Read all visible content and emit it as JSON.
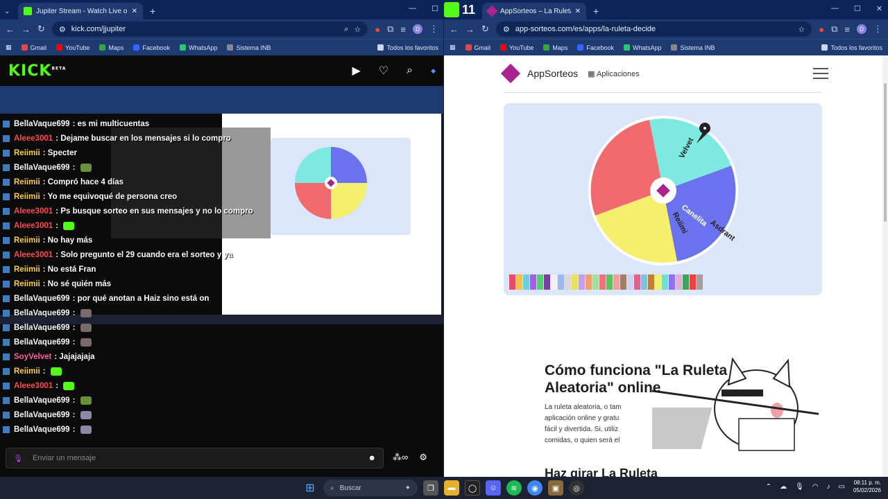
{
  "left_window": {
    "tab_title": "Jupiter Stream - Watch Live on",
    "url": "kick.com/jjupiter",
    "profile": "D",
    "bookmarks": [
      "Gmail",
      "YouTube",
      "Maps",
      "Facebook",
      "WhatsApp",
      "Sistema INB"
    ],
    "favorites": "Todos los favoritos",
    "kick_logo": "KICK",
    "kick_beta": "BETA",
    "chat": [
      {
        "user": "BellaVaque699",
        "text": "es mi multicuentas",
        "color": "#ffffff"
      },
      {
        "user": "Aleee3001",
        "text": "Dejame buscar en los mensajes si lo compro",
        "color": "#ff4d4d"
      },
      {
        "user": "Reiimii",
        "text": "Specter",
        "color": "#ffd23e"
      },
      {
        "user": "BellaVaque699",
        "text": "",
        "color": "#ffffff",
        "emote": "#6b8f3a"
      },
      {
        "user": "Reiimii",
        "text": "Compró hace 4 días",
        "color": "#ffd23e"
      },
      {
        "user": "Reiimii",
        "text": "Yo me equivoqué de persona creo",
        "color": "#ffd23e"
      },
      {
        "user": "Aleee3001",
        "text": "Ps busque sorteo en sus mensajes y no lo compro",
        "color": "#ff4d4d"
      },
      {
        "user": "Aleee3001",
        "text": "",
        "color": "#ff4d4d",
        "emote": "#53fc18"
      },
      {
        "user": "Reiimii",
        "text": "No hay más",
        "color": "#ffd23e"
      },
      {
        "user": "Aleee3001",
        "text": "Solo pregunto el 29 cuando era el sorteo y ya",
        "color": "#ff4d4d"
      },
      {
        "user": "Reiimii",
        "text": "No está Fran",
        "color": "#ffd23e"
      },
      {
        "user": "Reiimii",
        "text": "No sé quién más",
        "color": "#ffd23e"
      },
      {
        "user": "BellaVaque699",
        "text": "por qué anotan a Haiz sino está on",
        "color": "#ffffff"
      },
      {
        "user": "BellaVaque699",
        "text": "",
        "color": "#ffffff",
        "emote": "#7a6a6a"
      },
      {
        "user": "BellaVaque699",
        "text": "",
        "color": "#ffffff",
        "emote": "#7a6a6a"
      },
      {
        "user": "BellaVaque699",
        "text": "",
        "color": "#ffffff",
        "emote": "#7a6a6a"
      },
      {
        "user": "SoyVelvet",
        "text": "Jajajajaja",
        "color": "#ff5fa8"
      },
      {
        "user": "Reiimii",
        "text": "",
        "color": "#ffd23e",
        "emote": "#53fc18"
      },
      {
        "user": "Aleee3001",
        "text": "",
        "color": "#ff4d4d",
        "emote": "#53fc18"
      },
      {
        "user": "BellaVaque699",
        "text": "",
        "color": "#ffffff",
        "emote": "#6b8f3a"
      },
      {
        "user": "BellaVaque699",
        "text": "",
        "color": "#ffffff",
        "emote": "#8a8aa6"
      },
      {
        "user": "BellaVaque699",
        "text": "",
        "color": "#ffffff",
        "emote": "#8a8aa6"
      }
    ],
    "chat_placeholder": "Enviar un mensaje"
  },
  "right_window": {
    "tab_title": "AppSorteos – La Ruleta de la Su",
    "url": "app-sorteos.com/es/apps/la-ruleta-decide",
    "profile": "D",
    "bookmarks": [
      "Gmail",
      "YouTube",
      "Maps",
      "Facebook",
      "WhatsApp",
      "Sistema INB"
    ],
    "favorites": "Todos los favoritos",
    "brand": "AppSorteos",
    "apps_label": "Aplicaciones",
    "wheel_labels": [
      "Velvet",
      "Canelita",
      "Reiimi",
      "Asdrant"
    ],
    "wheel_colors": [
      "#7de9e0",
      "#6b72ee",
      "#f5ef6e",
      "#f06a6e"
    ],
    "heading1": "Cómo funciona \"La Ruleta",
    "heading1b": "Aleatoria\" online",
    "paragraph": [
      "La ruleta aleatoria, o tam",
      "aplicación online y gratu",
      "fácil y divertida. Si, utiliz",
      "comidas, o quien será el"
    ],
    "heading2": "Haz girar La Ruleta"
  },
  "taskbar": {
    "search": "Buscar",
    "time": "08:11 p. m.",
    "date": "05/02/2026"
  },
  "colors": {
    "kick_green": "#53fc18",
    "chrome_blue": "#1e3a70"
  }
}
